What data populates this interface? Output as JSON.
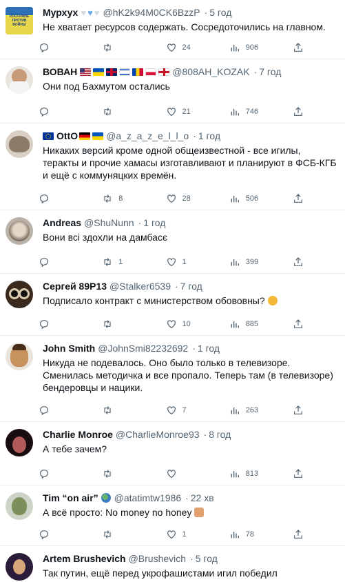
{
  "tweets": [
    {
      "name": "Мурхух",
      "handle": "@hK2k94M0CK6BzzP",
      "time": "5 год",
      "text": "Не хватает ресурсов содержать. Сосредоточились на главном.",
      "replies": "",
      "retweets": "",
      "likes": "24",
      "views": "906",
      "avatar_text": "РОССИЯНЕ ПРОТИВ ВОЙНЫ"
    },
    {
      "name": "ВОВАН",
      "handle": "@808AH_KOZAK",
      "time": "7 год",
      "text": "Они под Бахмутом остались",
      "replies": "",
      "retweets": "",
      "likes": "21",
      "views": "746"
    },
    {
      "name": "OttO",
      "handle": "@a_z_a_z_e_l_l_o",
      "time": "1 год",
      "text": "Никаких версий кроме одной общеизвестной - все игилы, теракты и прочие хамасы изготавливают и планируют в ФСБ-КГБ и ещё с коммуняцких времён.",
      "replies": "",
      "retweets": "8",
      "likes": "28",
      "views": "506"
    },
    {
      "name": "Andreas",
      "handle": "@ShuNunn",
      "time": "1 год",
      "text": "Вони всі здохли на дамбасє",
      "replies": "",
      "retweets": "1",
      "likes": "1",
      "views": "399"
    },
    {
      "name": "Сергей 89Р13",
      "handle": "@Stalker6539",
      "time": "7 год",
      "text": "Подписало контракт с министерством обововны?",
      "replies": "",
      "retweets": "",
      "likes": "10",
      "views": "885"
    },
    {
      "name": "John Smith",
      "handle": "@JohnSmi82232692",
      "time": "1 год",
      "text": "Никуда не подевалось. Оно было только в телевизоре. Сменилась методичка и все пропало. Теперь там (в телевизоре) бендеровцы и нацики.",
      "replies": "",
      "retweets": "",
      "likes": "7",
      "views": "263"
    },
    {
      "name": "Charlie Monroe",
      "handle": "@CharlieMonroe93",
      "time": "8 год",
      "text": "А тебе зачем?",
      "replies": "",
      "retweets": "",
      "likes": "",
      "views": "813"
    },
    {
      "name": "Tim “on air”",
      "handle": "@atatimtw1986",
      "time": "22 хв",
      "text": "А всё просто: No money no honey",
      "replies": "",
      "retweets": "",
      "likes": "1",
      "views": "78"
    },
    {
      "name": "Artem Brushevich",
      "handle": "@Brushevich",
      "time": "5 год",
      "text": "Так путин, ещё перед укрофашистами игил победил",
      "replies": "",
      "retweets": "",
      "likes": "",
      "views": ""
    }
  ],
  "colors": {
    "border": "#e6ecf0",
    "muted": "#536471",
    "text": "#0f1419"
  }
}
